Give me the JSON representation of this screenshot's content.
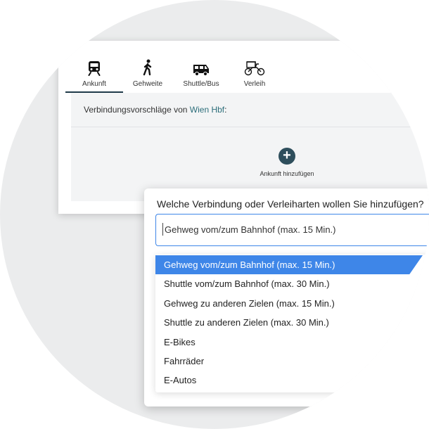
{
  "tabs": [
    {
      "label": "Ankunft",
      "icon": "train-icon",
      "active": true
    },
    {
      "label": "Gehweite",
      "icon": "walking-icon",
      "active": false
    },
    {
      "label": "Shuttle/Bus",
      "icon": "bus-icon",
      "active": false
    },
    {
      "label": "Verleih",
      "icon": "rickshaw-icon",
      "active": false
    }
  ],
  "suggestions": {
    "prefix": "Verbindungsvorschläge von ",
    "station": "Wien Hbf",
    "suffix": ":"
  },
  "add_button": {
    "icon": "plus-icon",
    "label": "Ankunft hinzufügen"
  },
  "dialog": {
    "title": "Welche Verbindung oder Verleiharten wollen Sie hinzufügen?",
    "select_value": "Gehweg vom/zum Bahnhof (max. 15 Min.)",
    "options": [
      "Gehweg vom/zum Bahnhof (max. 15 Min.)",
      "Shuttle vom/zum Bahnhof (max. 30 Min.)",
      "Gehweg zu anderen Zielen (max. 15 Min.)",
      "Shuttle zu anderen Zielen (max. 30 Min.)",
      "E-Bikes",
      "Fahrräder",
      "E-Autos"
    ],
    "selected_index": 0
  },
  "colors": {
    "accent": "#3e86e8",
    "dark": "#1f3a49",
    "station_link": "#2c6e7a",
    "background": "#ebeced"
  }
}
